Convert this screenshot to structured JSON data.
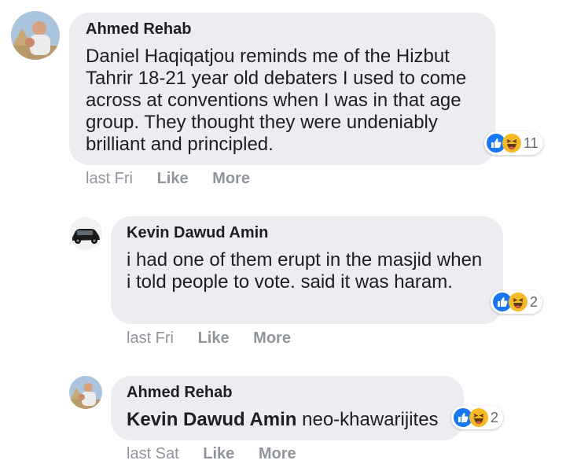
{
  "comments": [
    {
      "author": "Ahmed Rehab",
      "text": "Daniel Haqiqatjou reminds me of the Hizbut Tahrir 18-21 year old debaters I used to come across at conventions when I was in that age group. They thought they were undeniably brilliant and principled.",
      "reaction_count": "11",
      "time": "last Fri",
      "like_label": "Like",
      "more_label": "More",
      "avatar": "profile-photo"
    },
    {
      "author": "Kevin Dawud Amin",
      "text": "i had one of them erupt in the masjid when i told people to vote. said it was haram.",
      "reaction_count": "2",
      "time": "last Fri",
      "like_label": "Like",
      "more_label": "More",
      "avatar": "car-photo"
    },
    {
      "author": "Ahmed Rehab",
      "mention": "Kevin Dawud Amin",
      "text": "neo-khawarijites",
      "reaction_count": "2",
      "time": "last Sat",
      "like_label": "Like",
      "more_label": "More",
      "avatar": "profile-photo"
    }
  ],
  "colors": {
    "bubble": "#ebedf0",
    "like_blue": "#1877f2",
    "haha_yellow": "#f7b928",
    "meta_gray": "#90949c"
  }
}
